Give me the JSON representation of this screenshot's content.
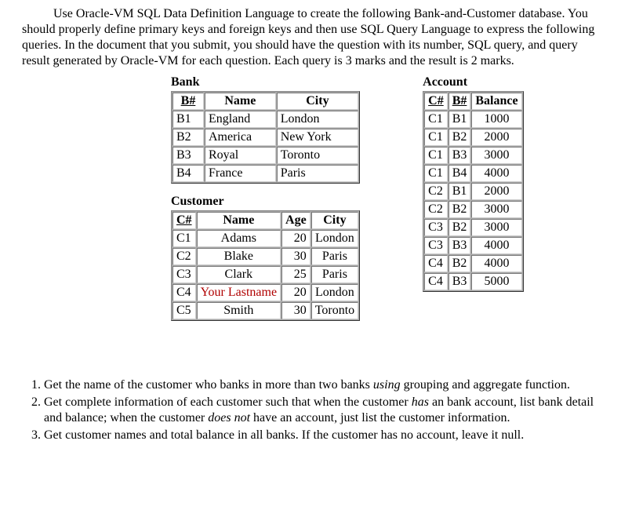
{
  "intro": "Use Oracle-VM SQL Data Definition Language to create the following Bank-and-Customer database. You should properly define primary keys and foreign keys and then use SQL Query Language to express the following queries. In the document that you submit, you should have the question with its number, SQL query, and query result generated by Oracle-VM for each question. Each query is 3 marks and the result is 2 marks.",
  "bank": {
    "label": "Bank",
    "headers": {
      "bnum": "B#",
      "name": "Name",
      "city": "City"
    },
    "rows": [
      {
        "bnum": "B1",
        "name": "England",
        "city": "London"
      },
      {
        "bnum": "B2",
        "name": "America",
        "city": "New York"
      },
      {
        "bnum": "B3",
        "name": "Royal",
        "city": "Toronto"
      },
      {
        "bnum": "B4",
        "name": "France",
        "city": "Paris"
      }
    ]
  },
  "customer": {
    "label": "Customer",
    "headers": {
      "cnum": "C#",
      "name": "Name",
      "age": "Age",
      "city": "City"
    },
    "rows": [
      {
        "cnum": "C1",
        "name": "Adams",
        "age": "20",
        "city": "London"
      },
      {
        "cnum": "C2",
        "name": "Blake",
        "age": "30",
        "city": "Paris"
      },
      {
        "cnum": "C3",
        "name": "Clark",
        "age": "25",
        "city": "Paris"
      },
      {
        "cnum": "C4",
        "name": "Your Lastname",
        "age": "20",
        "city": "London"
      },
      {
        "cnum": "C5",
        "name": "Smith",
        "age": "30",
        "city": "Toronto"
      }
    ]
  },
  "account": {
    "label": "Account",
    "headers": {
      "cnum": "C#",
      "bnum": "B#",
      "balance": "Balance"
    },
    "rows": [
      {
        "cnum": "C1",
        "bnum": "B1",
        "balance": "1000"
      },
      {
        "cnum": "C1",
        "bnum": "B2",
        "balance": "2000"
      },
      {
        "cnum": "C1",
        "bnum": "B3",
        "balance": "3000"
      },
      {
        "cnum": "C1",
        "bnum": "B4",
        "balance": "4000"
      },
      {
        "cnum": "C2",
        "bnum": "B1",
        "balance": "2000"
      },
      {
        "cnum": "C2",
        "bnum": "B2",
        "balance": "3000"
      },
      {
        "cnum": "C3",
        "bnum": "B2",
        "balance": "3000"
      },
      {
        "cnum": "C3",
        "bnum": "B3",
        "balance": "4000"
      },
      {
        "cnum": "C4",
        "bnum": "B2",
        "balance": "4000"
      },
      {
        "cnum": "C4",
        "bnum": "B3",
        "balance": "5000"
      }
    ]
  },
  "questions": {
    "q1_a": "Get the name of the customer who banks in more than two banks ",
    "q1_em": "using",
    "q1_b": " grouping and aggregate function.",
    "q2_a": "Get complete information of each customer such that when the customer ",
    "q2_em1": "has",
    "q2_b": " an bank account, list bank detail and balance; when the customer ",
    "q2_em2": "does not",
    "q2_c": " have an account, just list the customer information.",
    "q3": "Get customer names and total balance in all banks. If the customer has no account, leave it null."
  }
}
